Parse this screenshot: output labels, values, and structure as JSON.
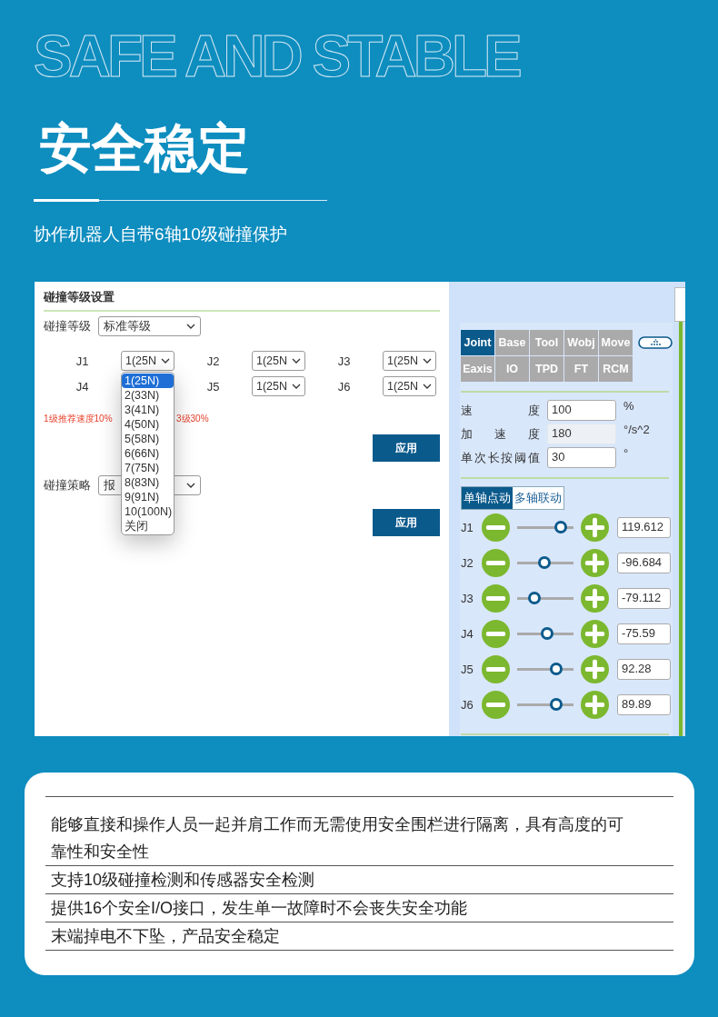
{
  "hero": {
    "outline_title": "SAFE AND STABLE",
    "title": "安全稳定",
    "subtitle": "协作机器人自带6轴10级碰撞保护"
  },
  "collision_panel": {
    "heading": "碰撞等级设置",
    "level_label": "碰撞等级",
    "level_value": "标准等级",
    "joints": [
      {
        "label": "J1",
        "value": "1(25N"
      },
      {
        "label": "J2",
        "value": "1(25N"
      },
      {
        "label": "J3",
        "value": "1(25N"
      },
      {
        "label": "J4"
      },
      {
        "label": "J5",
        "value": "1(25N"
      },
      {
        "label": "J6",
        "value": "1(25N"
      }
    ],
    "dropdown_options": [
      {
        "label": "1(25N)",
        "selected": true
      },
      {
        "label": "2(33N)",
        "selected": false
      },
      {
        "label": "3(41N)",
        "selected": false
      },
      {
        "label": "4(50N)",
        "selected": false
      },
      {
        "label": "5(58N)",
        "selected": false
      },
      {
        "label": "6(66N)",
        "selected": false
      },
      {
        "label": "7(75N)",
        "selected": false
      },
      {
        "label": "8(83N)",
        "selected": false
      },
      {
        "label": "9(91N)",
        "selected": false
      },
      {
        "label": "10(100N)",
        "selected": false
      },
      {
        "label": "关闭",
        "selected": false
      }
    ],
    "hint_left": "1级推荐速度10%",
    "hint_right": "3级30%",
    "apply_buttons": [
      "应用",
      "应用"
    ],
    "strategy_label": "碰撞策略",
    "strategy_value": "报"
  },
  "jog_panel": {
    "mode_tabs": [
      {
        "label": "Joint",
        "selected": true
      },
      {
        "label": "Base",
        "selected": false
      },
      {
        "label": "Tool",
        "selected": false
      },
      {
        "label": "Wobj",
        "selected": false
      },
      {
        "label": "Move",
        "selected": false
      },
      {
        "label": "Eaxis",
        "selected": false
      },
      {
        "label": "IO",
        "selected": false
      },
      {
        "label": "TPD",
        "selected": false
      },
      {
        "label": "FT",
        "selected": false
      },
      {
        "label": "RCM",
        "selected": false
      }
    ],
    "fields": [
      {
        "label": "速度",
        "value": "100",
        "unit": "%",
        "disabled": false
      },
      {
        "label": "加速度",
        "value": "180",
        "unit": "°/s^2",
        "disabled": true
      },
      {
        "label": "单次长按阈值",
        "value": "30",
        "unit": "°",
        "disabled": false
      }
    ],
    "jog_tabs": [
      {
        "label": "单轴点动",
        "selected": true
      },
      {
        "label": "多轴联动",
        "selected": false
      }
    ],
    "axes": [
      {
        "label": "J1",
        "level": 0.77,
        "value": "119.612"
      },
      {
        "label": "J2",
        "level": 0.48,
        "value": "-96.684"
      },
      {
        "label": "J3",
        "level": 0.3,
        "value": "-79.112"
      },
      {
        "label": "J4",
        "level": 0.53,
        "value": "-75.59"
      },
      {
        "label": "J5",
        "level": 0.7,
        "value": "92.28"
      },
      {
        "label": "J6",
        "level": 0.69,
        "value": "89.89"
      }
    ]
  },
  "features": [
    "能够直接和操作人员一起并肩工作而无需使用安全围栏进行隔离，具有高度的可靠性和安全性",
    "支持10级碰撞检测和传感器安全检测",
    "提供16个安全I/O接口，发生单一故障时不会丧失安全功能",
    "末端掉电不下坠，产品安全稳定"
  ]
}
